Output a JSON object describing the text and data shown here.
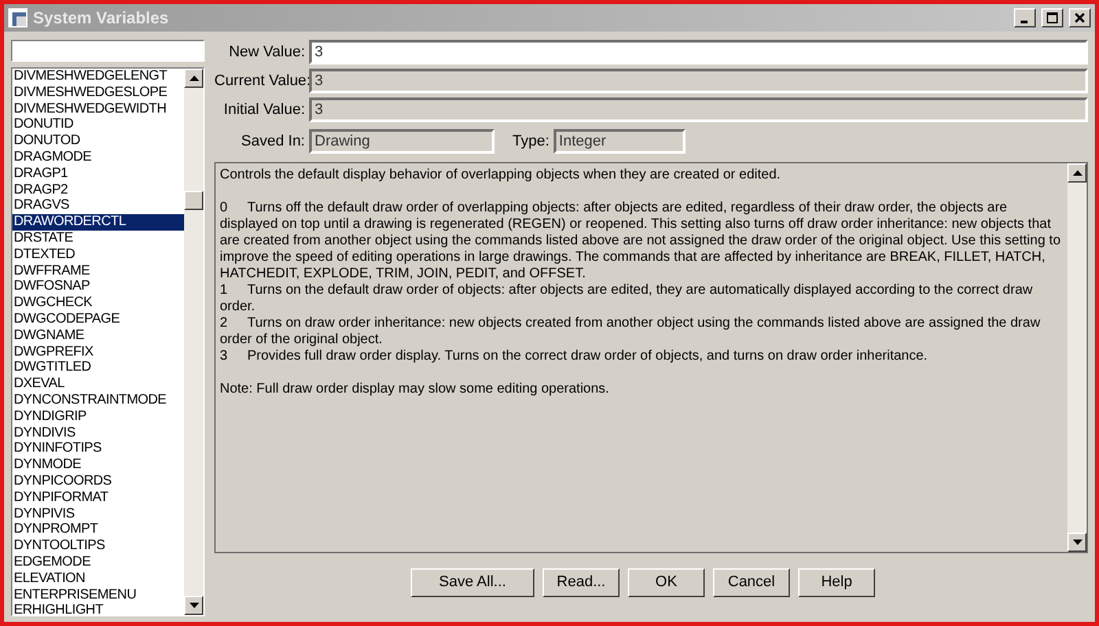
{
  "window": {
    "title": "System Variables"
  },
  "variables": [
    {
      "name": "DIVMESHWEDGELENGT",
      "selected": false
    },
    {
      "name": "DIVMESHWEDGESLOPE",
      "selected": false
    },
    {
      "name": "DIVMESHWEDGEWIDTH",
      "selected": false
    },
    {
      "name": "DONUTID",
      "selected": false
    },
    {
      "name": "DONUTOD",
      "selected": false
    },
    {
      "name": "DRAGMODE",
      "selected": false
    },
    {
      "name": "DRAGP1",
      "selected": false
    },
    {
      "name": "DRAGP2",
      "selected": false
    },
    {
      "name": "DRAGVS",
      "selected": false
    },
    {
      "name": "DRAWORDERCTL",
      "selected": true
    },
    {
      "name": "DRSTATE",
      "selected": false
    },
    {
      "name": "DTEXTED",
      "selected": false
    },
    {
      "name": "DWFFRAME",
      "selected": false
    },
    {
      "name": "DWFOSNAP",
      "selected": false
    },
    {
      "name": "DWGCHECK",
      "selected": false
    },
    {
      "name": "DWGCODEPAGE",
      "selected": false
    },
    {
      "name": "DWGNAME",
      "selected": false
    },
    {
      "name": "DWGPREFIX",
      "selected": false
    },
    {
      "name": "DWGTITLED",
      "selected": false
    },
    {
      "name": "DXEVAL",
      "selected": false
    },
    {
      "name": "DYNCONSTRAINTMODE",
      "selected": false
    },
    {
      "name": "DYNDIGRIP",
      "selected": false
    },
    {
      "name": "DYNDIVIS",
      "selected": false
    },
    {
      "name": "DYNINFOTIPS",
      "selected": false
    },
    {
      "name": "DYNMODE",
      "selected": false
    },
    {
      "name": "DYNPICOORDS",
      "selected": false
    },
    {
      "name": "DYNPIFORMAT",
      "selected": false
    },
    {
      "name": "DYNPIVIS",
      "selected": false
    },
    {
      "name": "DYNPROMPT",
      "selected": false
    },
    {
      "name": "DYNTOOLTIPS",
      "selected": false
    },
    {
      "name": "EDGEMODE",
      "selected": false
    },
    {
      "name": "ELEVATION",
      "selected": false
    },
    {
      "name": "ENTERPRISEMENU",
      "selected": false
    },
    {
      "name": "ERHIGHLIGHT",
      "selected": false
    }
  ],
  "fields": {
    "new_value": {
      "label": "New Value:",
      "value": "3"
    },
    "current_value": {
      "label": "Current Value:",
      "value": "3"
    },
    "initial_value": {
      "label": "Initial Value:",
      "value": "3"
    },
    "saved_in": {
      "label": "Saved In:",
      "value": "Drawing"
    },
    "type": {
      "label": "Type:",
      "value": "Integer"
    }
  },
  "description": [
    {
      "kind": "paragraph",
      "text": "Controls the default display behavior of overlapping objects when they are created or edited."
    },
    {
      "kind": "blank"
    },
    {
      "kind": "option",
      "number": "0",
      "text": "Turns off the default draw order of overlapping objects: after objects are edited, regardless of their draw order, the objects are displayed on top until a drawing is regenerated (REGEN) or reopened. This setting also turns off draw order inheritance: new objects that are created from another object using the commands listed above are not assigned the draw order of the original object. Use this setting to improve the speed of editing operations in large drawings. The commands that are affected by inheritance are BREAK, FILLET, HATCH, HATCHEDIT, EXPLODE, TRIM, JOIN, PEDIT, and OFFSET."
    },
    {
      "kind": "option",
      "number": "1",
      "text": "Turns on the default draw order of objects: after objects are edited, they are automatically displayed according to the correct draw order."
    },
    {
      "kind": "option",
      "number": "2",
      "text": "Turns on draw order inheritance: new objects created from another object using the commands listed above are assigned the draw order of the original object."
    },
    {
      "kind": "option",
      "number": "3",
      "text": "Provides full draw order display. Turns on the correct draw order of objects, and turns on draw order inheritance."
    },
    {
      "kind": "blank"
    },
    {
      "kind": "paragraph",
      "text": "Note: Full draw order display may slow some editing operations."
    }
  ],
  "buttons": [
    "Save All...",
    "Read...",
    "OK",
    "Cancel",
    "Help"
  ]
}
